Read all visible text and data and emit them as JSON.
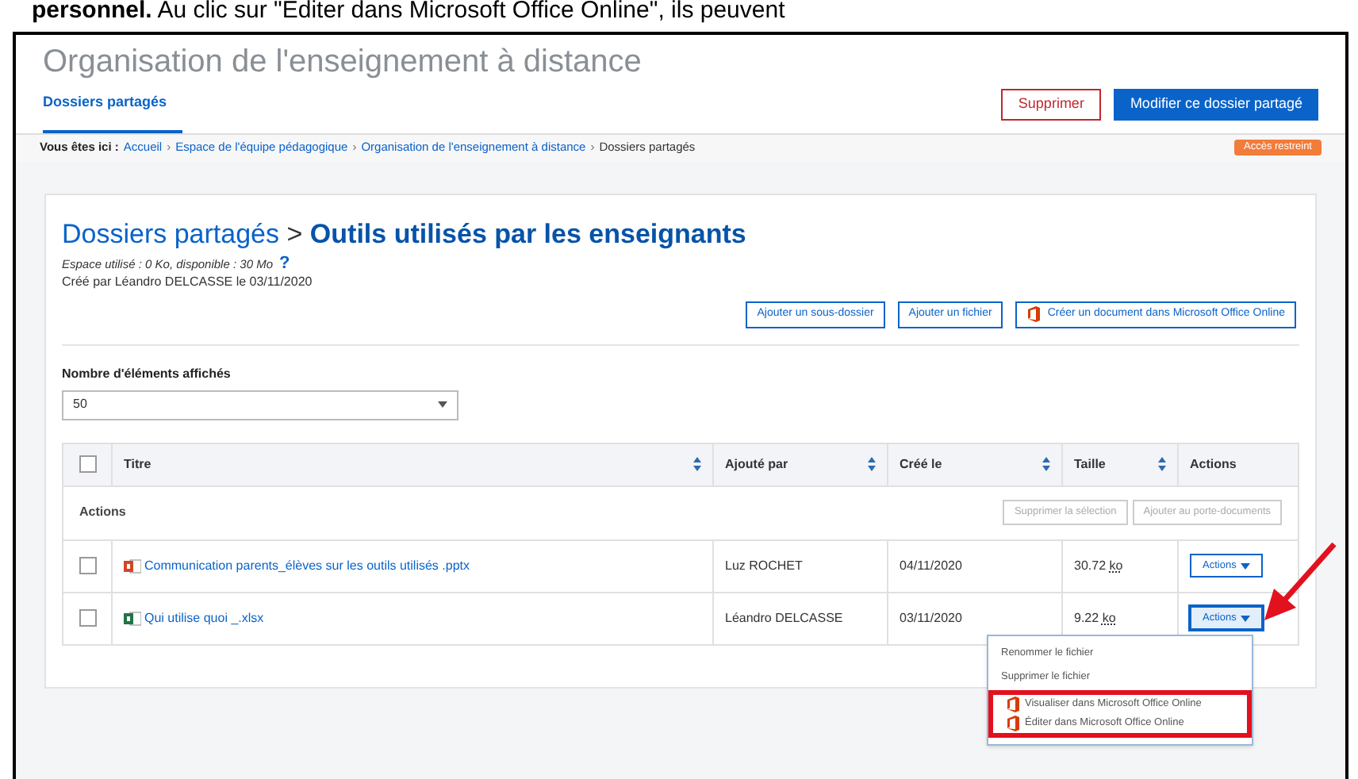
{
  "caption": "**personnel.** Au clic sur \"Editer dans Microsoft Office Online\", ils peuvent",
  "header": {
    "title": "Organisation de l'enseignement à distance",
    "tabs": [
      {
        "label": "Dossiers partagés",
        "selected": true
      }
    ],
    "buttons": [
      {
        "label": "Supprimer",
        "kind": "danger"
      },
      {
        "label": "Modifier ce dossier partagé",
        "kind": "primary"
      }
    ]
  },
  "breadcrumb": {
    "label": "Vous êtes ici :",
    "separator": "›",
    "items": [
      {
        "label": "Accueil",
        "link": true
      },
      {
        "label": "Espace de l'équipe pédagogique",
        "link": true
      },
      {
        "label": "Organisation de l'enseignement à distance",
        "link": true
      },
      {
        "label": "Dossiers partagés",
        "link": false
      }
    ],
    "badge": "Accès restreint"
  },
  "folder": {
    "parent": "Dossiers partagés",
    "separator": ">",
    "name": "Outils utilisés par les enseignants",
    "usage": "Espace utilisé : 0 Ko, disponible : 30 Mo",
    "help": "?",
    "created": "Créé par Léandro DELCASSE le 03/11/2020"
  },
  "toolbar": [
    {
      "label": "Ajouter un sous-dossier",
      "kind": "plain"
    },
    {
      "label": "Ajouter un fichier",
      "kind": "plain"
    },
    {
      "label": "Créer un document dans Microsoft Office Online",
      "kind": "office"
    }
  ],
  "page_size": {
    "label": "Nombre d'éléments affichés",
    "value": "50"
  },
  "table": {
    "select_all": {
      "checked": false
    },
    "columns": [
      {
        "label": "Titre",
        "sortable": true
      },
      {
        "label": "Ajouté par",
        "sortable": true
      },
      {
        "label": "Créé le",
        "sortable": true
      },
      {
        "label": "Taille",
        "sortable": true
      },
      {
        "label": "Actions",
        "sortable": false
      }
    ],
    "bulk": {
      "label": "Actions",
      "buttons": [
        {
          "label": "Supprimer la sélection",
          "disabled": true
        },
        {
          "label": "Ajouter au porte-documents",
          "disabled": true
        }
      ]
    },
    "rows": [
      {
        "kind": "pptx",
        "checked": false,
        "title": "Communication parents_élèves sur les outils utilisés .pptx",
        "added_by": "Luz ROCHET",
        "created": "04/11/2020",
        "size": "30.72",
        "unit": "ko",
        "actions": "Actions",
        "expanded": false
      },
      {
        "kind": "xlsx",
        "checked": false,
        "title": "Qui utilise quoi _.xlsx",
        "added_by": "Léandro DELCASSE",
        "created": "03/11/2020",
        "size": "9.22",
        "unit": "ko",
        "actions": "Actions",
        "expanded": true
      }
    ]
  },
  "menu": {
    "items": [
      {
        "label": "Renommer le fichier",
        "kind": "plain",
        "highlighted": false
      },
      {
        "label": "Supprimer le fichier",
        "kind": "plain",
        "highlighted": false
      },
      {
        "label": "Visualiser dans Microsoft Office Online",
        "kind": "office",
        "highlighted": true
      },
      {
        "label": "Éditer dans Microsoft Office Online",
        "kind": "office",
        "highlighted": true
      }
    ]
  }
}
